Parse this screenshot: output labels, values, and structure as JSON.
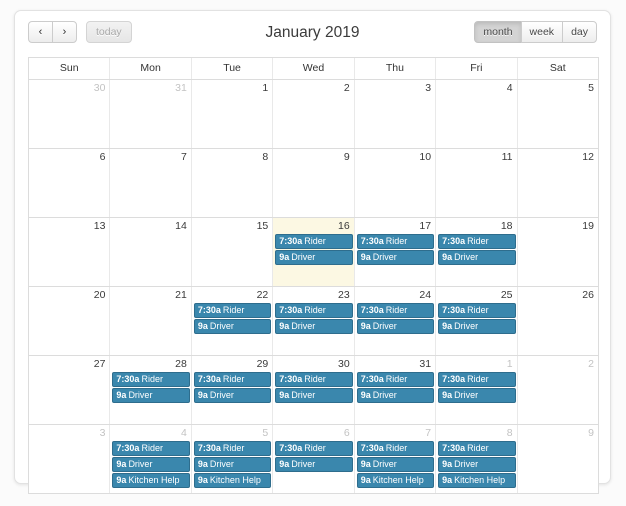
{
  "toolbar": {
    "prev_label": "‹",
    "next_label": "›",
    "today_label": "today",
    "title": "January 2019",
    "views": [
      {
        "key": "month",
        "label": "month",
        "active": true
      },
      {
        "key": "week",
        "label": "week",
        "active": false
      },
      {
        "key": "day",
        "label": "day",
        "active": false
      }
    ]
  },
  "calendar": {
    "day_headers": [
      "Sun",
      "Mon",
      "Tue",
      "Wed",
      "Thu",
      "Fri",
      "Sat"
    ],
    "accent_color": "#3a87ad",
    "today_color": "#fcf8e3",
    "weeks": [
      {
        "days": [
          {
            "num": "30",
            "other": true,
            "today": false,
            "events": []
          },
          {
            "num": "31",
            "other": true,
            "today": false,
            "events": []
          },
          {
            "num": "1",
            "other": false,
            "today": false,
            "events": []
          },
          {
            "num": "2",
            "other": false,
            "today": false,
            "events": []
          },
          {
            "num": "3",
            "other": false,
            "today": false,
            "events": []
          },
          {
            "num": "4",
            "other": false,
            "today": false,
            "events": []
          },
          {
            "num": "5",
            "other": false,
            "today": false,
            "events": []
          }
        ]
      },
      {
        "days": [
          {
            "num": "6",
            "other": false,
            "today": false,
            "events": []
          },
          {
            "num": "7",
            "other": false,
            "today": false,
            "events": []
          },
          {
            "num": "8",
            "other": false,
            "today": false,
            "events": []
          },
          {
            "num": "9",
            "other": false,
            "today": false,
            "events": []
          },
          {
            "num": "10",
            "other": false,
            "today": false,
            "events": []
          },
          {
            "num": "11",
            "other": false,
            "today": false,
            "events": []
          },
          {
            "num": "12",
            "other": false,
            "today": false,
            "events": []
          }
        ]
      },
      {
        "days": [
          {
            "num": "13",
            "other": false,
            "today": false,
            "events": []
          },
          {
            "num": "14",
            "other": false,
            "today": false,
            "events": []
          },
          {
            "num": "15",
            "other": false,
            "today": false,
            "events": []
          },
          {
            "num": "16",
            "other": false,
            "today": true,
            "events": [
              {
                "time": "7:30a",
                "title": "Rider"
              },
              {
                "time": "9a",
                "title": "Driver"
              }
            ]
          },
          {
            "num": "17",
            "other": false,
            "today": false,
            "events": [
              {
                "time": "7:30a",
                "title": "Rider"
              },
              {
                "time": "9a",
                "title": "Driver"
              }
            ]
          },
          {
            "num": "18",
            "other": false,
            "today": false,
            "events": [
              {
                "time": "7:30a",
                "title": "Rider"
              },
              {
                "time": "9a",
                "title": "Driver"
              }
            ]
          },
          {
            "num": "19",
            "other": false,
            "today": false,
            "events": []
          }
        ]
      },
      {
        "days": [
          {
            "num": "20",
            "other": false,
            "today": false,
            "events": []
          },
          {
            "num": "21",
            "other": false,
            "today": false,
            "events": []
          },
          {
            "num": "22",
            "other": false,
            "today": false,
            "events": [
              {
                "time": "7:30a",
                "title": "Rider"
              },
              {
                "time": "9a",
                "title": "Driver"
              }
            ]
          },
          {
            "num": "23",
            "other": false,
            "today": false,
            "events": [
              {
                "time": "7:30a",
                "title": "Rider"
              },
              {
                "time": "9a",
                "title": "Driver"
              }
            ]
          },
          {
            "num": "24",
            "other": false,
            "today": false,
            "events": [
              {
                "time": "7:30a",
                "title": "Rider"
              },
              {
                "time": "9a",
                "title": "Driver"
              }
            ]
          },
          {
            "num": "25",
            "other": false,
            "today": false,
            "events": [
              {
                "time": "7:30a",
                "title": "Rider"
              },
              {
                "time": "9a",
                "title": "Driver"
              }
            ]
          },
          {
            "num": "26",
            "other": false,
            "today": false,
            "events": []
          }
        ]
      },
      {
        "days": [
          {
            "num": "27",
            "other": false,
            "today": false,
            "events": []
          },
          {
            "num": "28",
            "other": false,
            "today": false,
            "events": [
              {
                "time": "7:30a",
                "title": "Rider"
              },
              {
                "time": "9a",
                "title": "Driver"
              }
            ]
          },
          {
            "num": "29",
            "other": false,
            "today": false,
            "events": [
              {
                "time": "7:30a",
                "title": "Rider"
              },
              {
                "time": "9a",
                "title": "Driver"
              }
            ]
          },
          {
            "num": "30",
            "other": false,
            "today": false,
            "events": [
              {
                "time": "7:30a",
                "title": "Rider"
              },
              {
                "time": "9a",
                "title": "Driver"
              }
            ]
          },
          {
            "num": "31",
            "other": false,
            "today": false,
            "events": [
              {
                "time": "7:30a",
                "title": "Rider"
              },
              {
                "time": "9a",
                "title": "Driver"
              }
            ]
          },
          {
            "num": "1",
            "other": true,
            "today": false,
            "events": [
              {
                "time": "7:30a",
                "title": "Rider"
              },
              {
                "time": "9a",
                "title": "Driver"
              }
            ]
          },
          {
            "num": "2",
            "other": true,
            "today": false,
            "events": []
          }
        ]
      },
      {
        "days": [
          {
            "num": "3",
            "other": true,
            "today": false,
            "events": []
          },
          {
            "num": "4",
            "other": true,
            "today": false,
            "events": [
              {
                "time": "7:30a",
                "title": "Rider"
              },
              {
                "time": "9a",
                "title": "Driver"
              },
              {
                "time": "9a",
                "title": "Kitchen Help"
              }
            ]
          },
          {
            "num": "5",
            "other": true,
            "today": false,
            "events": [
              {
                "time": "7:30a",
                "title": "Rider"
              },
              {
                "time": "9a",
                "title": "Driver"
              },
              {
                "time": "9a",
                "title": "Kitchen Help"
              }
            ]
          },
          {
            "num": "6",
            "other": true,
            "today": false,
            "events": [
              {
                "time": "7:30a",
                "title": "Rider"
              },
              {
                "time": "9a",
                "title": "Driver"
              }
            ]
          },
          {
            "num": "7",
            "other": true,
            "today": false,
            "events": [
              {
                "time": "7:30a",
                "title": "Rider"
              },
              {
                "time": "9a",
                "title": "Driver"
              },
              {
                "time": "9a",
                "title": "Kitchen Help"
              }
            ]
          },
          {
            "num": "8",
            "other": true,
            "today": false,
            "events": [
              {
                "time": "7:30a",
                "title": "Rider"
              },
              {
                "time": "9a",
                "title": "Driver"
              },
              {
                "time": "9a",
                "title": "Kitchen Help"
              }
            ]
          },
          {
            "num": "9",
            "other": true,
            "today": false,
            "events": []
          }
        ]
      }
    ]
  }
}
